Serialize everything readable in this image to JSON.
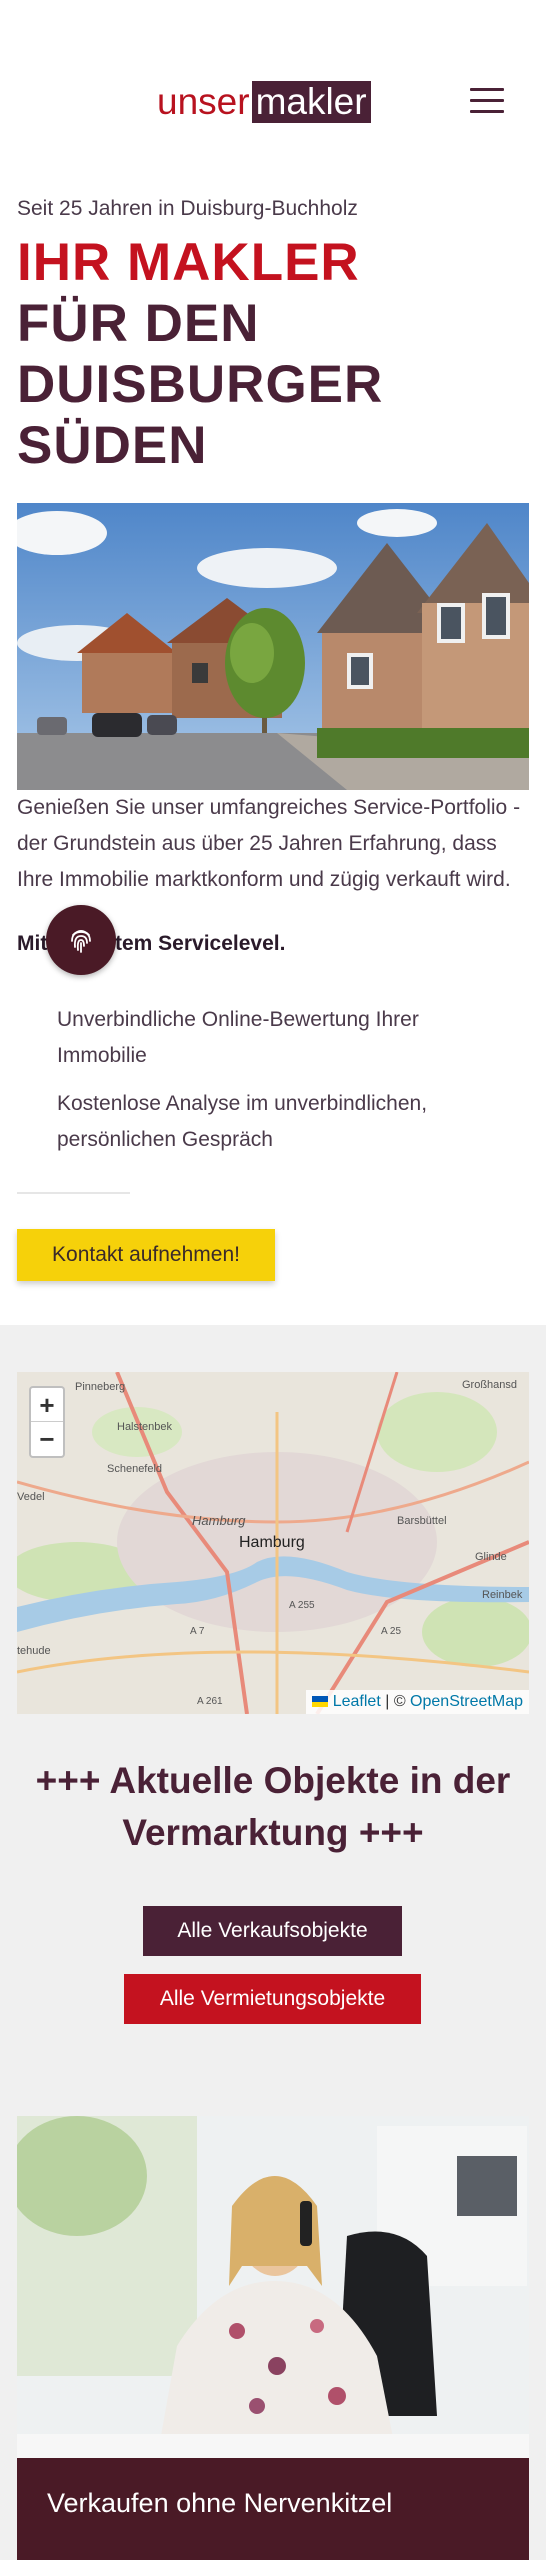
{
  "header": {
    "logo_part1": "unser",
    "logo_part2": "makler",
    "menu_icon": "hamburger-menu-icon"
  },
  "hero": {
    "subtitle": "Seit 25 Jahren in Duisburg-Buchholz",
    "title_line1": "IHR MAKLER",
    "title_line2": "FÜR DEN",
    "title_line3": "DUISBURGER",
    "title_line4": "SÜDEN"
  },
  "intro": {
    "text": "Genießen Sie unser umfangreiches Service-Portfolio - der Grundstein aus über 25 Jahren Erfahrung, dass Ihre Immobilie marktkonform und zügig verkauft wird.",
    "bold": "Mit höchstem Servicelevel."
  },
  "features": [
    "Unverbindliche Online-Bewertung Ihrer Immobilie",
    "Kostenlose Analyse im unverbindlichen, persönlichen Gespräch"
  ],
  "cta": {
    "label": "Kontakt aufnehmen!"
  },
  "map": {
    "zoom_in": "+",
    "zoom_out": "−",
    "attribution_leaflet": "Leaflet",
    "attribution_sep": " | © ",
    "attribution_osm": "OpenStreetMap",
    "labels": {
      "hamburg": "Hamburg",
      "hamburg_river": "Hamburg",
      "pinneberg": "Pinneberg",
      "halstenbek": "Halstenbek",
      "schenefeld": "Schenefeld",
      "grosshansd": "Großhansd",
      "barsbuettel": "Barsbüttel",
      "glinde": "Glinde",
      "reinbek": "Reinbek",
      "wedel": "Vedel",
      "rehude": "tehude",
      "a7": "A 7",
      "a255": "A 255",
      "a25": "A 25",
      "a261": "A 261"
    }
  },
  "objects": {
    "title": "+++ Aktuelle Objekte in der Vermarktung +++",
    "sale_label": "Alle Verkaufsobjekte",
    "rent_label": "Alle Vermietungsobjekte"
  },
  "sell": {
    "label": "Verkaufen ohne Nervenkitzel"
  },
  "colors": {
    "brand_purple": "#4a2136",
    "brand_red": "#c4121f",
    "cta_yellow": "#f6d10a"
  }
}
